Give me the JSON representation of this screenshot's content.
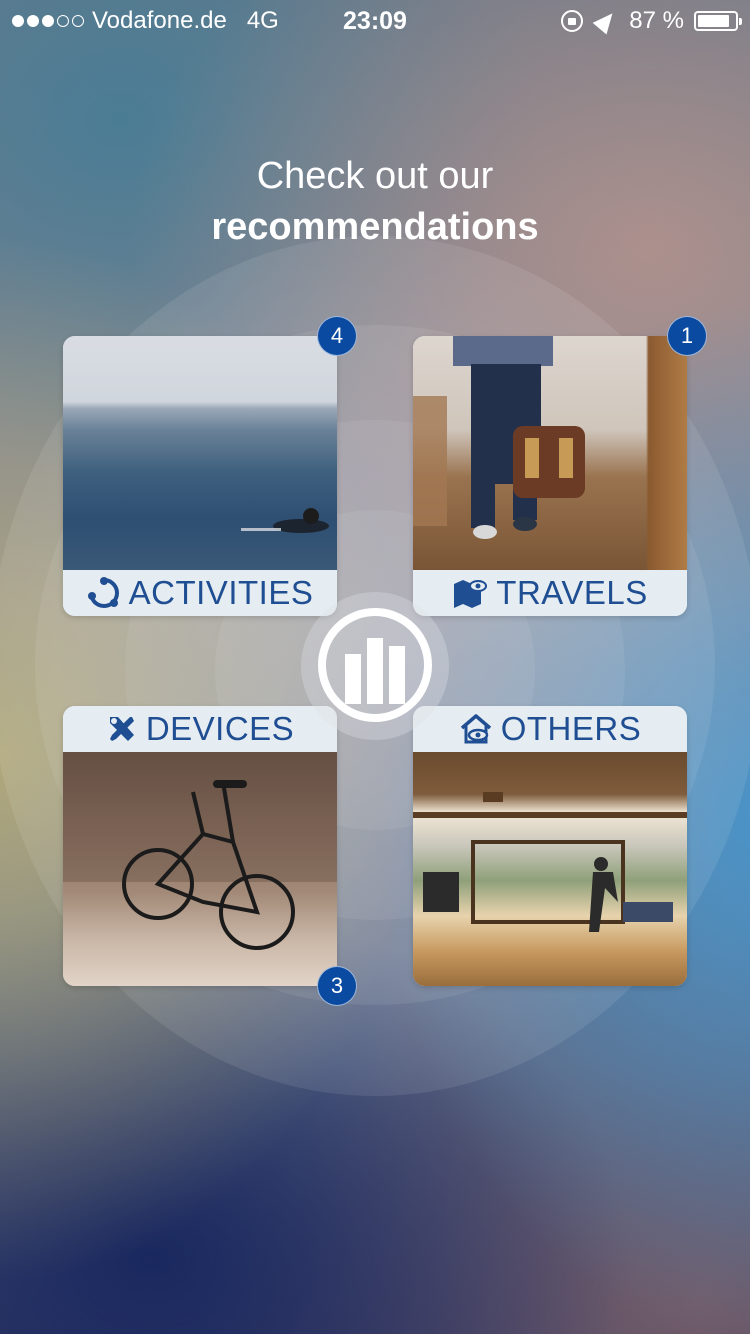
{
  "status_bar": {
    "signal_dots_filled": 3,
    "signal_dots_total": 5,
    "carrier": "Vodafone.de",
    "network": "4G",
    "time": "23:09",
    "battery": "87 %",
    "battery_level_percent": 87
  },
  "heading": {
    "line1": "Check out our",
    "line2": "recommendations"
  },
  "categories": [
    {
      "label": "ACTIVITIES",
      "icon": "activities-icon",
      "badge": "4"
    },
    {
      "label": "TRAVELS",
      "icon": "travel-map-icon",
      "badge": "1"
    },
    {
      "label": "DEVICES",
      "icon": "tools-icon",
      "badge": "3"
    },
    {
      "label": "OTHERS",
      "icon": "home-eye-icon",
      "badge": ""
    }
  ],
  "center_logo": "allianz-logo-icon",
  "colors": {
    "accent": "#1f4e93",
    "badge": "#0a4aa0",
    "label_bg": "#e6edf2"
  }
}
